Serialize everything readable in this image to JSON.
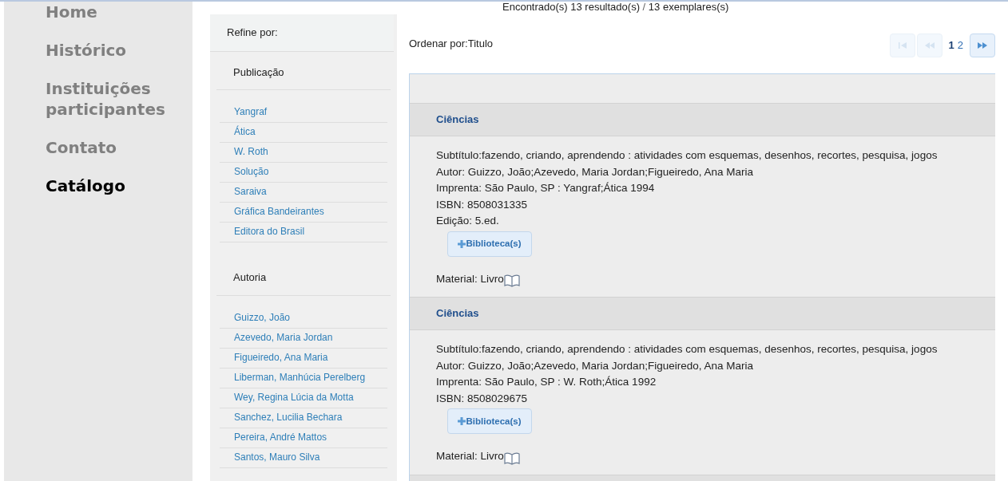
{
  "nav": [
    {
      "label": "Home",
      "selected": false
    },
    {
      "label": "Histórico",
      "selected": false
    },
    {
      "label": "Instituições participantes",
      "selected": false
    },
    {
      "label": "Contato",
      "selected": false
    },
    {
      "label": "Catálogo",
      "selected": true
    }
  ],
  "refine": {
    "title": "Refine por:",
    "groups": [
      {
        "title": "Publicação",
        "items": [
          "Yangraf",
          "Ática",
          "W. Roth",
          "Solução",
          "Saraiva",
          "Gráfica Bandeirantes",
          "Editora do Brasil"
        ]
      },
      {
        "title": "Autoria",
        "items": [
          "Guizzo, João",
          "Azevedo, Maria Jordan",
          "Figueiredo, Ana Maria",
          "Liberman, Manhúcia Perelberg",
          "Wey, Regina Lúcia da Motta",
          "Sanchez, Lucilia Bechara",
          "Pereira, André Mattos",
          "Santos, Mauro Silva"
        ]
      }
    ]
  },
  "summary": {
    "found": "Encontrado(s) 13 resultado(s)",
    "separator": "/",
    "copies": "13 exemplares(s)"
  },
  "sort": "Ordenar por:Titulo",
  "pagination": {
    "first": {
      "disabled": true
    },
    "prev": {
      "disabled": true
    },
    "pages": [
      {
        "label": "1",
        "selected": true
      },
      {
        "label": "2",
        "selected": false
      }
    ],
    "next": {
      "disabled": false
    }
  },
  "records": [
    {
      "title": "Ciências",
      "fields": [
        "Subtítulo:fazendo, criando, aprendendo : atividades com esquemas, desenhos, recortes, pesquisa, jogos",
        "Autor: Guizzo, João;Azevedo, Maria Jordan;Figueiredo, Ana Maria",
        "Imprenta: São Paulo, SP : Yangraf;Ática 1994",
        "ISBN: 8508031335",
        "Edição: 5.ed."
      ],
      "button": "Biblioteca(s)",
      "material": "Material: Livro"
    },
    {
      "title": "Ciências",
      "fields": [
        "Subtítulo:fazendo, criando, aprendendo : atividades com esquemas, desenhos, recortes, pesquisa, jogos",
        "Autor: Guizzo, João;Azevedo, Maria Jordan;Figueiredo, Ana Maria",
        "Imprenta: São Paulo, SP : W. Roth;Ática 1992",
        "ISBN: 8508029675"
      ],
      "button": "Biblioteca(s)",
      "material": "Material: Livro"
    }
  ]
}
